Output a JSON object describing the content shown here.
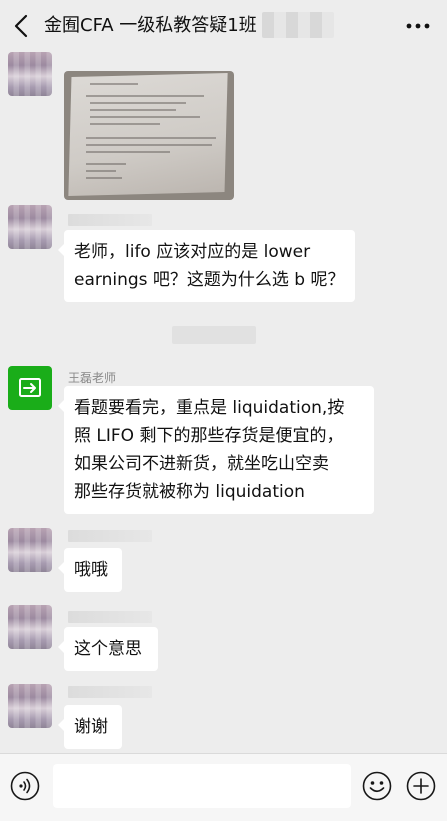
{
  "header": {
    "title": "金囿CFA 一级私教答疑1班",
    "back_icon": "chevron-left-icon",
    "more_icon": "more-dots-icon"
  },
  "messages": [
    {
      "type": "image",
      "description_icon": "photo-thumbnail"
    },
    {
      "type": "text",
      "text_lines": [
        "老师，lifo 应该对应的是 lower",
        "earnings 吧？这题为什么选 b 呢？"
      ]
    },
    {
      "type": "text",
      "sender": "王磊老师",
      "text_lines": [
        "看题要看完，重点是 liquidation,按",
        "照 LIFO 剩下的那些存货是便宜的，",
        "如果公司不进新货，就坐吃山空卖",
        "那些存货就被称为 liquidation"
      ]
    },
    {
      "type": "text",
      "text_lines": [
        "哦哦"
      ]
    },
    {
      "type": "text",
      "text_lines": [
        "这个意思"
      ]
    },
    {
      "type": "text",
      "text_lines": [
        "谢谢"
      ]
    }
  ],
  "input_bar": {
    "voice_icon": "voice-icon",
    "emoji_icon": "emoji-icon",
    "plus_icon": "plus-icon"
  },
  "colors": {
    "background": "#ededed",
    "bubble": "#ffffff",
    "teacher_avatar": "#1aad19"
  }
}
